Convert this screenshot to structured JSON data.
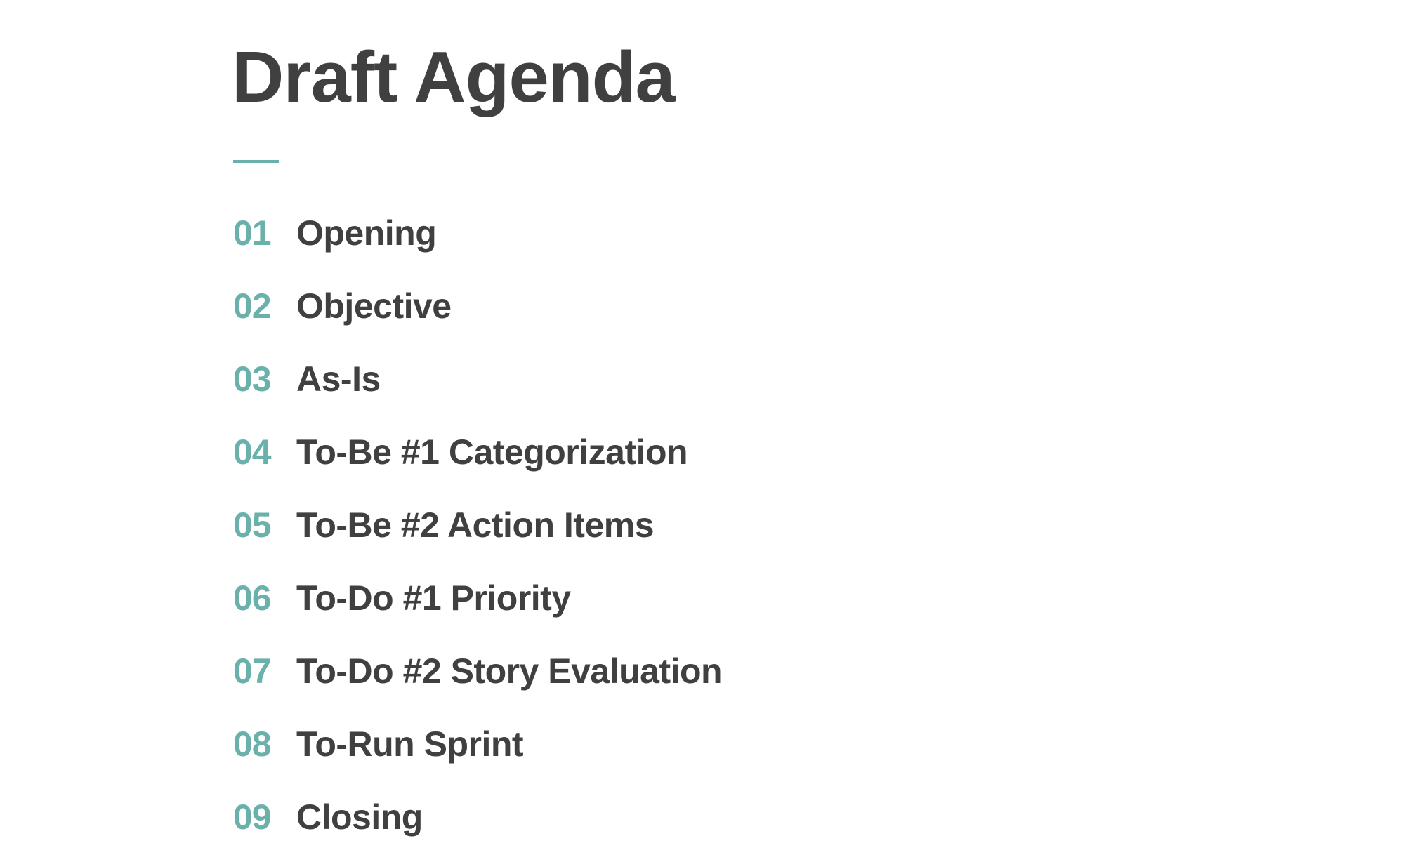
{
  "title": "Draft Agenda",
  "colors": {
    "accent": "#6ab0ab",
    "text": "#404040",
    "background": "#ffffff"
  },
  "agenda": [
    {
      "num": "01",
      "label": "Opening"
    },
    {
      "num": "02",
      "label": "Objective"
    },
    {
      "num": "03",
      "label": "As-Is"
    },
    {
      "num": "04",
      "label": "To-Be #1 Categorization"
    },
    {
      "num": "05",
      "label": "To-Be #2 Action Items"
    },
    {
      "num": "06",
      "label": "To-Do #1 Priority"
    },
    {
      "num": "07",
      "label": "To-Do #2 Story Evaluation"
    },
    {
      "num": "08",
      "label": "To-Run Sprint"
    },
    {
      "num": "09",
      "label": "Closing"
    }
  ]
}
